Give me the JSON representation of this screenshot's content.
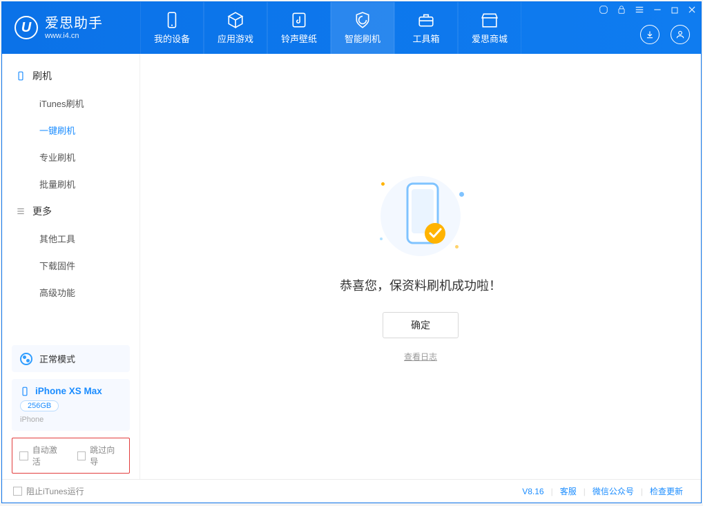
{
  "app": {
    "title": "爱思助手",
    "url": "www.i4.cn"
  },
  "nav": {
    "items": [
      {
        "label": "我的设备",
        "icon": "device"
      },
      {
        "label": "应用游戏",
        "icon": "cube"
      },
      {
        "label": "铃声壁纸",
        "icon": "music"
      },
      {
        "label": "智能刷机",
        "icon": "shield"
      },
      {
        "label": "工具箱",
        "icon": "toolbox"
      },
      {
        "label": "爱思商城",
        "icon": "store"
      }
    ],
    "active_index": 3
  },
  "window_controls": {
    "feedback_icon": "feedback",
    "lock_icon": "lock",
    "menu_icon": "menu",
    "minimize_icon": "minimize",
    "maximize_icon": "maximize",
    "close_icon": "close"
  },
  "header_buttons": {
    "download": "download",
    "user": "user"
  },
  "sidebar": {
    "cat_flash": "刷机",
    "flash_items": [
      "iTunes刷机",
      "一键刷机",
      "专业刷机",
      "批量刷机"
    ],
    "flash_active_index": 1,
    "cat_more": "更多",
    "more_items": [
      "其他工具",
      "下载固件",
      "高级功能"
    ],
    "mode_label": "正常模式",
    "device": {
      "name": "iPhone XS Max",
      "capacity": "256GB",
      "type": "iPhone"
    },
    "opts": {
      "auto_activate": "自动激活",
      "skip_guide": "跳过向导"
    }
  },
  "main": {
    "success_text": "恭喜您，保资料刷机成功啦！",
    "ok_label": "确定",
    "log_label": "查看日志"
  },
  "footer": {
    "block_itunes": "阻止iTunes运行",
    "version": "V8.16",
    "links": [
      "客服",
      "微信公众号",
      "检查更新"
    ]
  }
}
